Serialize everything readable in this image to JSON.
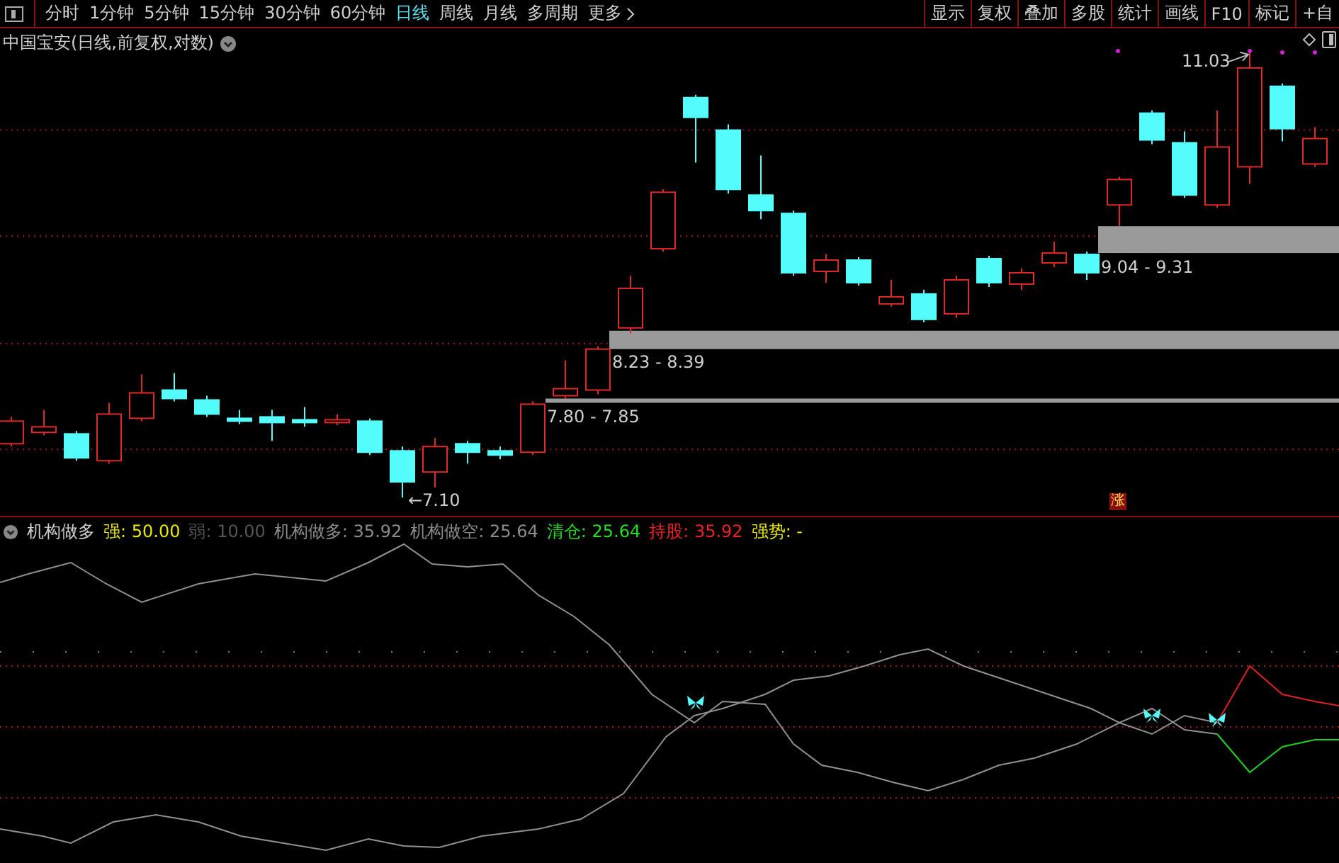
{
  "period_tabs": [
    {
      "label": "分时",
      "selected": false
    },
    {
      "label": "1分钟",
      "selected": false
    },
    {
      "label": "5分钟",
      "selected": false
    },
    {
      "label": "15分钟",
      "selected": false
    },
    {
      "label": "30分钟",
      "selected": false
    },
    {
      "label": "60分钟",
      "selected": false
    },
    {
      "label": "日线",
      "selected": true
    },
    {
      "label": "周线",
      "selected": false
    },
    {
      "label": "月线",
      "selected": false
    },
    {
      "label": "多周期",
      "selected": false
    }
  ],
  "more_button": "更多",
  "toolbar_buttons": [
    "显示",
    "复权",
    "叠加",
    "多股",
    "统计",
    "画线",
    "F10",
    "标记",
    "+自"
  ],
  "chart_title": "中国宝安(日线,前复权,对数)",
  "price_labels": [
    {
      "text": "←7.10"
    },
    {
      "text": "7.80 - 7.85"
    },
    {
      "text": "8.23 - 8.39"
    },
    {
      "text": "9.04 - 9.31"
    },
    {
      "text": "11.03"
    }
  ],
  "rise_tag": "涨",
  "indicator": {
    "name": "机构做多",
    "values": [
      {
        "text": "强: 50.00",
        "color": "#e8e800"
      },
      {
        "text": "弱: 10.00",
        "color": "#555555"
      },
      {
        "text": "机构做多: 35.92",
        "color": "#8c8c8c"
      },
      {
        "text": "机构做空: 25.64",
        "color": "#8c8c8c"
      },
      {
        "text": "清仓: 25.64",
        "color": "#22dd22"
      },
      {
        "text": "持股: 35.92",
        "color": "#ee2222"
      },
      {
        "text": "强势: -",
        "color": "#e8e800"
      }
    ]
  }
}
